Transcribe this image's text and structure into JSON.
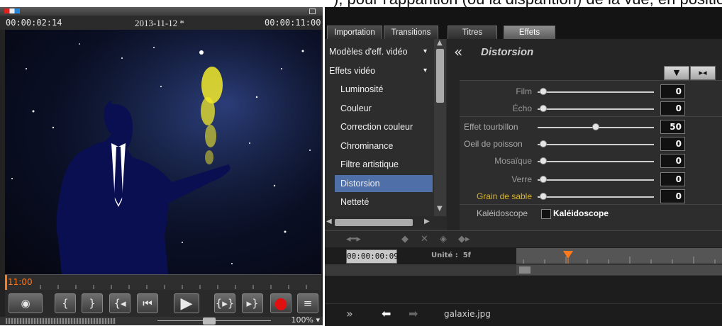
{
  "crop_text": "), pour l'apparition (ou la disparition) de la vue, en positionnant le curseur",
  "preview": {
    "date_label": "2013-11-12 *",
    "time_current": "00:00:02:14",
    "time_total": "00:00:11:00",
    "ruler_label": "11:00",
    "zoom": "100%"
  },
  "transport": {
    "buttons": [
      {
        "name": "clip-button",
        "glyph": "◉"
      },
      {
        "name": "mark-in-button",
        "glyph": "{"
      },
      {
        "name": "mark-out-button",
        "glyph": "}"
      },
      {
        "name": "go-to-in-button",
        "glyph": "{◂"
      },
      {
        "name": "previous-button",
        "glyph": "⏮"
      },
      {
        "name": "play-button",
        "glyph": "▶"
      },
      {
        "name": "play-range-button",
        "glyph": "{▸}"
      },
      {
        "name": "go-to-out-button",
        "glyph": "▸}"
      },
      {
        "name": "record-button",
        "glyph": "●"
      },
      {
        "name": "menu-button",
        "glyph": "≡"
      }
    ]
  },
  "tabs": [
    "Importation",
    "Transitions",
    "Titres",
    "Effets"
  ],
  "active_tab": "Effets",
  "categories": [
    {
      "label": "Modèles d'eff. vidéo",
      "type": "top",
      "expander": "▾"
    },
    {
      "label": "Effets vidéo",
      "type": "top",
      "expander": "▾"
    },
    {
      "label": "Luminosité",
      "type": "sub"
    },
    {
      "label": "Couleur",
      "type": "sub"
    },
    {
      "label": "Correction couleur",
      "type": "sub"
    },
    {
      "label": "Chrominance",
      "type": "sub"
    },
    {
      "label": "Filtre artistique",
      "type": "sub"
    },
    {
      "label": "Distorsion",
      "type": "sub",
      "selected": true
    },
    {
      "label": "Netteté",
      "type": "sub"
    }
  ],
  "effect": {
    "back_glyph": "«",
    "title": "Distorsion",
    "sliders": [
      {
        "label": "Film",
        "value": "0",
        "level": 0,
        "align": "right"
      },
      {
        "label": "Écho",
        "value": "0",
        "level": 0,
        "align": "right"
      },
      {
        "label": "Effet tourbillon",
        "value": "50",
        "level": 0.5,
        "align": "left"
      },
      {
        "label": "Oeil de poisson",
        "value": "0",
        "level": 0,
        "align": "left"
      },
      {
        "label": "Mosaïque",
        "value": "0",
        "level": 0,
        "align": "right"
      },
      {
        "label": "Verre",
        "value": "0",
        "level": 0,
        "align": "right"
      },
      {
        "label": "Grain de sable",
        "value": "0",
        "level": 0,
        "align": "right",
        "highlight": true
      }
    ],
    "kaleidoscope_label": "Kaléidoscope",
    "kaleidoscope_check_label": "Kaléidoscope"
  },
  "timeline": {
    "timecode": "00:00:00:09",
    "unit_label": "Unité :",
    "unit_value": "5f"
  },
  "bottom": {
    "filename": "galaxie.jpg"
  },
  "colors": {
    "selection": "#4e6fa8",
    "record_red": "#e01010",
    "highlight_label": "#d8b430",
    "playhead": "#ff7a1a"
  }
}
